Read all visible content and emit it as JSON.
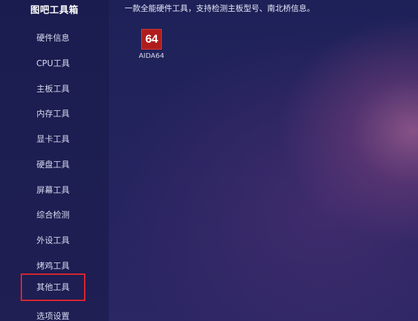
{
  "app": {
    "title": "图吧工具箱"
  },
  "sidebar": {
    "items": [
      {
        "label": "硬件信息"
      },
      {
        "label": "CPU工具"
      },
      {
        "label": "主板工具"
      },
      {
        "label": "内存工具"
      },
      {
        "label": "显卡工具"
      },
      {
        "label": "硬盘工具"
      },
      {
        "label": "屏幕工具"
      },
      {
        "label": "综合检测"
      },
      {
        "label": "外设工具"
      },
      {
        "label": "烤鸡工具"
      },
      {
        "label": "其他工具"
      },
      {
        "label": "选项设置"
      }
    ]
  },
  "main": {
    "description": "一款全能硬件工具，支持检测主板型号、南北桥信息。",
    "tools": [
      {
        "name": "AIDA64",
        "icon_text": "64",
        "icon_color": "#b01c1c"
      }
    ]
  },
  "colors": {
    "highlight_border": "#e0252c",
    "sidebar_bg": "#1c1e50"
  }
}
